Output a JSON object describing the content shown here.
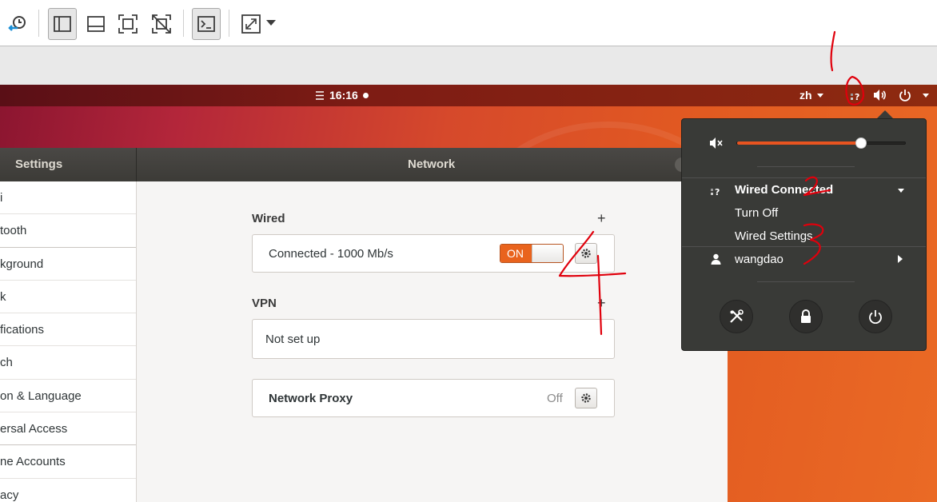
{
  "vm_toolbar": {
    "icons": [
      "snapshot-manager-icon",
      "console-view-icon",
      "thumbnail-view-icon",
      "fullscreen-icon",
      "unity-icon",
      "terminal-icon",
      "stretch-guest-icon",
      "dropdown-caret-icon"
    ]
  },
  "topbar": {
    "clock": "16:16",
    "language": "zh"
  },
  "settings": {
    "sidebar_title": "Settings",
    "panel_title": "Network",
    "sidebar_items": [
      {
        "label": "i"
      },
      {
        "label": "tooth"
      },
      {
        "label": "kground"
      },
      {
        "label": "k"
      },
      {
        "label": "fications"
      },
      {
        "label": "ch"
      },
      {
        "label": "on & Language"
      },
      {
        "label": "ersal Access"
      },
      {
        "label": "ne Accounts"
      },
      {
        "label": "acy"
      }
    ],
    "wired": {
      "heading": "Wired",
      "add_glyph": "+",
      "status": "Connected - 1000 Mb/s",
      "toggle_label": "ON"
    },
    "vpn": {
      "heading": "VPN",
      "add_glyph": "+",
      "status": "Not set up"
    },
    "proxy": {
      "label": "Network Proxy",
      "state": "Off"
    }
  },
  "system_menu": {
    "volume_level": 0.74,
    "wired_title": "Wired Connected",
    "turn_off": "Turn Off",
    "wired_settings": "Wired Settings",
    "user": "wangdao"
  },
  "colors": {
    "accent": "#e95420",
    "menu_bg": "#393a37",
    "header_bg": "#3c3b37",
    "annotation": "#e0000c"
  }
}
